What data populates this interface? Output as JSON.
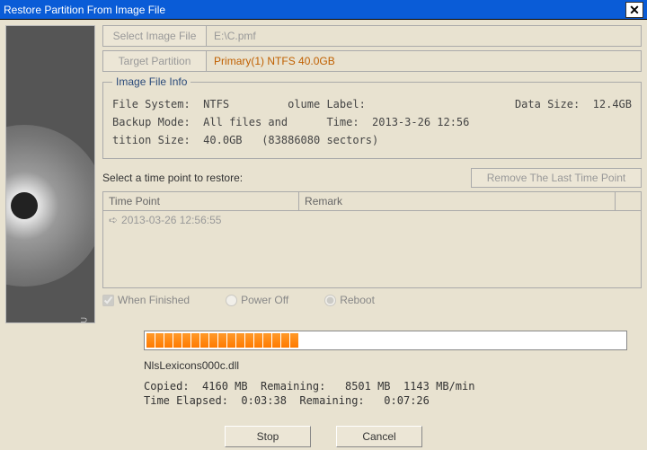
{
  "window": {
    "title": "Restore Partition From Image File"
  },
  "buttons": {
    "select_image_file": "Select Image File",
    "target_partition": "Target Partition",
    "remove_tp": "Remove The Last Time Point",
    "stop": "Stop",
    "cancel": "Cancel"
  },
  "fields": {
    "image_path": "E:\\C.pmf",
    "target_partition": "Primary(1) NTFS 40.0GB"
  },
  "info_legend": "Image File Info",
  "info": {
    "line1": "File System:  NTFS         olume Label:                       Data Size:  12.4GB",
    "line2": "Backup Mode:  All files and      Time:  2013-3-26 12:56",
    "line3": "tition Size:  40.0GB   (83886080 sectors)"
  },
  "select_label": "Select a time point to restore:",
  "grid": {
    "col1": "Time Point",
    "col2": "Remark",
    "row1": "2013-03-26 12:56:55"
  },
  "finish": {
    "when_finished": "When Finished",
    "power_off": "Power Off",
    "reboot": "Reboot"
  },
  "progress": {
    "segments_total": 50,
    "segments_filled": 17,
    "current_file": "NlsLexicons000c.dll",
    "stats": "Copied:  4160 MB  Remaining:   8501 MB  1143 MB/min\nTime Elapsed:  0:03:38  Remaining:   0:07:26"
  },
  "colors": {
    "titlebar": "#0a5cd7",
    "accent": "#ff7a00",
    "target": "#c06000"
  }
}
